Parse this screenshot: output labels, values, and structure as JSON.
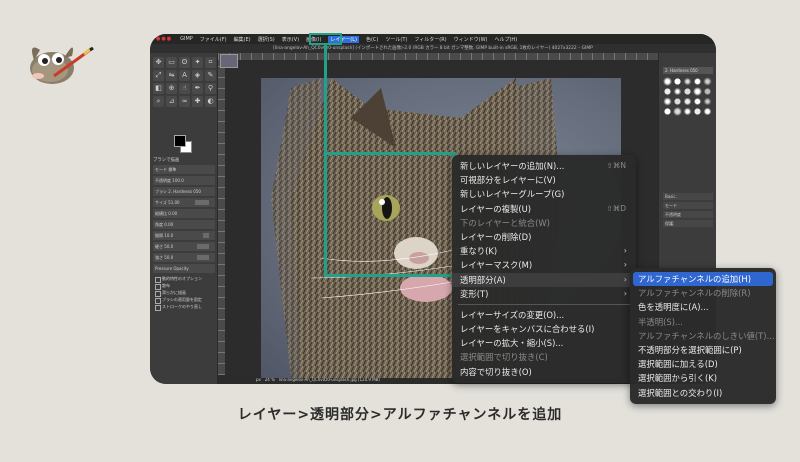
{
  "menubar": {
    "app": "GIMP",
    "items": [
      "ファイル(F)",
      "編集(E)",
      "選択(S)",
      "表示(V)",
      "画像(I)",
      "レイヤー(L)",
      "色(C)",
      "ツール(T)",
      "フィルター(R)",
      "ウィンドウ(W)",
      "ヘルプ(H)"
    ],
    "active_item": "レイヤー(L)"
  },
  "titlebar": "[lina-angelov-Ah_QC0v0z0-unsplash] (インポートされた画像)-2.0 (RGB カラー 8 bit ガンマ整数, GIMP built-in sRGB, 1枚のレイヤー) 4027x3222 – GIMP",
  "toolbox": {
    "options_title": "ブラシで描画",
    "mode_label": "モード",
    "mode_value": "標準",
    "opacity_label": "不透明度",
    "opacity_value": "100.0",
    "brush_label": "ブラシ",
    "brush_value": "2. Hardness 050",
    "rows": [
      "サイズ  51.00",
      "縦横比  0.00",
      "角度  0.00",
      "間隔  10.0",
      "硬さ  50.0",
      "強さ  50.0"
    ],
    "dynamics_label": "動的特性",
    "dynamics_value": "Pressure Opacity",
    "checks": [
      "動的特性のオプション",
      "散布",
      "滑らかに描画",
      "ブラシの適用量を固定",
      "ストロークのやり直し"
    ]
  },
  "statusbar": {
    "unit": "px",
    "zoom": "24 %",
    "filename": "lina-angelov-Ah_QC0v0z0-unsplash.jpg (120.9 MB)"
  },
  "dock": {
    "brush_name": "2. Hardness 050",
    "rows": [
      "Basic.",
      "モード",
      "不透明度",
      "保護:"
    ],
    "layer_name": "lina"
  },
  "layer_menu": {
    "items": [
      {
        "label": "新しいレイヤーの追加(N)...",
        "shortcut": "⇧⌘N",
        "state": "normal"
      },
      {
        "label": "可視部分をレイヤーに(V)",
        "shortcut": "",
        "state": "normal"
      },
      {
        "label": "新しいレイヤーグループ(G)",
        "shortcut": "",
        "state": "normal"
      },
      {
        "label": "レイヤーの複製(U)",
        "shortcut": "⇧⌘D",
        "state": "normal"
      },
      {
        "label": "下のレイヤーと統合(W)",
        "shortcut": "",
        "state": "disabled"
      },
      {
        "label": "レイヤーの削除(D)",
        "shortcut": "",
        "state": "normal"
      },
      {
        "label": "重なり(K)",
        "shortcut": "",
        "state": "submenu"
      },
      {
        "label": "レイヤーマスク(M)",
        "shortcut": "",
        "state": "submenu"
      },
      {
        "label": "透明部分(A)",
        "shortcut": "",
        "state": "submenu-open"
      },
      {
        "label": "変形(T)",
        "shortcut": "",
        "state": "submenu"
      },
      {
        "label": "レイヤーサイズの変更(O)...",
        "shortcut": "",
        "state": "normal"
      },
      {
        "label": "レイヤーをキャンバスに合わせる(I)",
        "shortcut": "",
        "state": "normal"
      },
      {
        "label": "レイヤーの拡大・縮小(S)...",
        "shortcut": "",
        "state": "normal"
      },
      {
        "label": "選択範囲で切り抜き(C)",
        "shortcut": "",
        "state": "disabled"
      },
      {
        "label": "内容で切り抜き(O)",
        "shortcut": "",
        "state": "normal"
      }
    ]
  },
  "transparency_menu": {
    "items": [
      {
        "label": "アルファチャンネルの追加(H)",
        "state": "active"
      },
      {
        "label": "アルファチャンネルの削除(R)",
        "state": "disabled"
      },
      {
        "label": "色を透明度に(A)...",
        "state": "normal"
      },
      {
        "label": "半透明(S)...",
        "state": "disabled"
      },
      {
        "label": "アルファチャンネルのしきい値(T)...",
        "state": "disabled"
      },
      {
        "label": "不透明部分を選択範囲に(P)",
        "state": "normal"
      },
      {
        "label": "選択範囲に加える(D)",
        "state": "normal"
      },
      {
        "label": "選択範囲から引く(K)",
        "state": "normal"
      },
      {
        "label": "選択範囲との交わり(I)",
        "state": "normal"
      }
    ]
  },
  "caption": "レイヤー>透明部分>アルファチャンネルを追加",
  "colors": {
    "highlight": "#23a088",
    "menu_active": "#2f66d0",
    "background": "#e3e1da"
  }
}
